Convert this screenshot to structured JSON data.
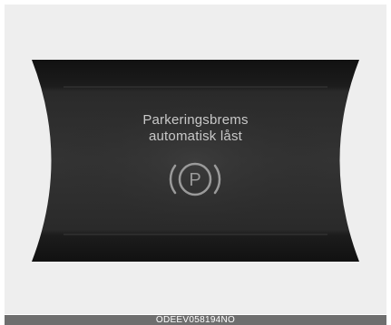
{
  "display": {
    "message_line1": "Parkeringsbrems",
    "message_line2": "automatisk låst",
    "icon": "parking-brake-icon",
    "icon_letter": "P"
  },
  "footer": {
    "code": "ODEEV058194NO"
  },
  "colors": {
    "background": "#eeeeee",
    "panel": "#1a1a1a",
    "text": "#c8c8c8",
    "footer_bar": "#6e6e6e"
  }
}
